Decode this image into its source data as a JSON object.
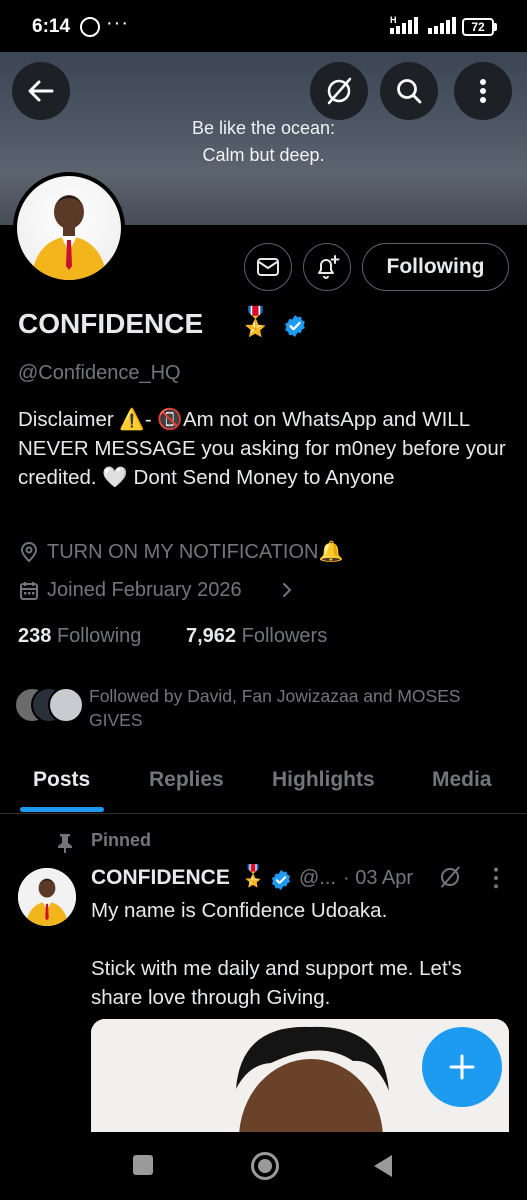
{
  "status_bar": {
    "time": "6:14",
    "dots": "···",
    "battery": "72"
  },
  "banner": {
    "line1": "Be like the ocean:",
    "line2": "Calm but deep."
  },
  "header_icons": [
    "back-arrow-icon",
    "grok-icon",
    "search-icon",
    "more-vertical-icon"
  ],
  "profile": {
    "display_name": "CONFIDENCE",
    "medal": "🎖️",
    "handle": "@Confidence_HQ",
    "bio": "Disclaimer ⚠️- 📵Am not on WhatsApp and WILL NEVER MESSAGE you asking for m0ney before your credited. 🤍 Dont Send Money to Anyone",
    "location": "TURN ON MY NOTIFICATION🔔",
    "joined": "Joined February 2026",
    "following_count": "238",
    "following_label": "Following",
    "followers_count": "7,962",
    "followers_label": "Followers",
    "followed_by": "Followed by David, Fan Jowizazaa and MOSES GIVES"
  },
  "actions": {
    "following_button": "Following"
  },
  "tabs": [
    {
      "label": "Posts",
      "active": true
    },
    {
      "label": "Replies",
      "active": false
    },
    {
      "label": "Highlights",
      "active": false
    },
    {
      "label": "Media",
      "active": false
    }
  ],
  "pinned_post": {
    "pinned_label": "Pinned",
    "name": "CONFIDENCE",
    "medal": "🎖️",
    "handle": "@...",
    "date": "· 03 Apr",
    "text": "My name is Confidence Udoaka.\n\nStick with me daily and support me. Let's share love through Giving."
  },
  "colors": {
    "accent": "#1d9bf0",
    "muted": "#71767b",
    "text": "#e7e9ea",
    "background": "#000000"
  }
}
